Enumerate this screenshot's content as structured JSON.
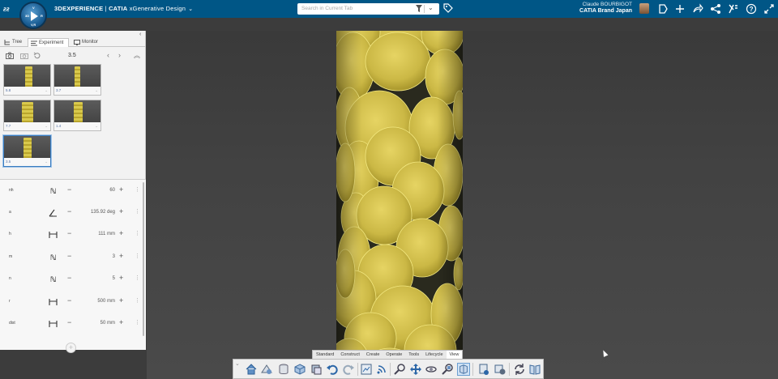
{
  "topbar": {
    "brand_strong": "3DEXPERIENCE",
    "brand_sep": " | ",
    "brand_app": "CATIA",
    "brand_product": " xGenerative Design",
    "compass_letters": [
      "3D",
      "V",
      "R",
      "V,R"
    ],
    "search_placeholder": "Search in Current Tab",
    "user_name": "Claude BOURBIGOT",
    "tenant": "CATIA Brand Japan",
    "icons": [
      "tag-icon",
      "bookmark-icon",
      "add-icon",
      "share-forward-icon",
      "share-icon",
      "tools-icon",
      "help-icon",
      "expand-icon"
    ]
  },
  "panel": {
    "tabs": [
      {
        "label": "Tree",
        "icon": "tree-icon"
      },
      {
        "label": "Experiment",
        "icon": "experiment-icon"
      },
      {
        "label": "Monitor",
        "icon": "monitor-icon"
      }
    ],
    "toolbar_value": "3.5",
    "thumbnails": [
      {
        "label": "5.8"
      },
      {
        "label": "3.7"
      },
      {
        "label": "7.7"
      },
      {
        "label": "1.4"
      },
      {
        "label": "3.5"
      }
    ],
    "params": [
      {
        "name": "nh",
        "type_icon": "integer-icon",
        "value": "60"
      },
      {
        "name": "a",
        "type_icon": "angle-icon",
        "value": "135.92 deg"
      },
      {
        "name": "h",
        "type_icon": "length-icon",
        "value": "111 mm"
      },
      {
        "name": "m",
        "type_icon": "integer-icon",
        "value": "3"
      },
      {
        "name": "n",
        "type_icon": "integer-icon",
        "value": "5"
      },
      {
        "name": "r",
        "type_icon": "length-icon",
        "value": "500 mm"
      },
      {
        "name": "dist",
        "type_icon": "length-icon",
        "value": "50 mm"
      }
    ]
  },
  "actionbar": {
    "tabs": [
      "Standard",
      "Construct",
      "Create",
      "Operate",
      "Tools",
      "Lifecycle",
      "View"
    ],
    "active_tab": "View",
    "tools": [
      "home-icon",
      "plan-icon",
      "database-icon",
      "cube-select-icon",
      "cube-copy-icon",
      "undo-icon",
      "redo-icon",
      "capture-icon",
      "signal-icon",
      "zoom-icon",
      "pan-icon",
      "rotate-icon",
      "zoom-fit-icon",
      "view-mode-icon",
      "layer-icon",
      "gear-cube-icon",
      "refresh-icon",
      "book-icon"
    ]
  },
  "colors": {
    "topbar": "#005686",
    "sphere": "#d8c74e",
    "sphere_edge": "#f3e880",
    "viewport": "#434343"
  }
}
